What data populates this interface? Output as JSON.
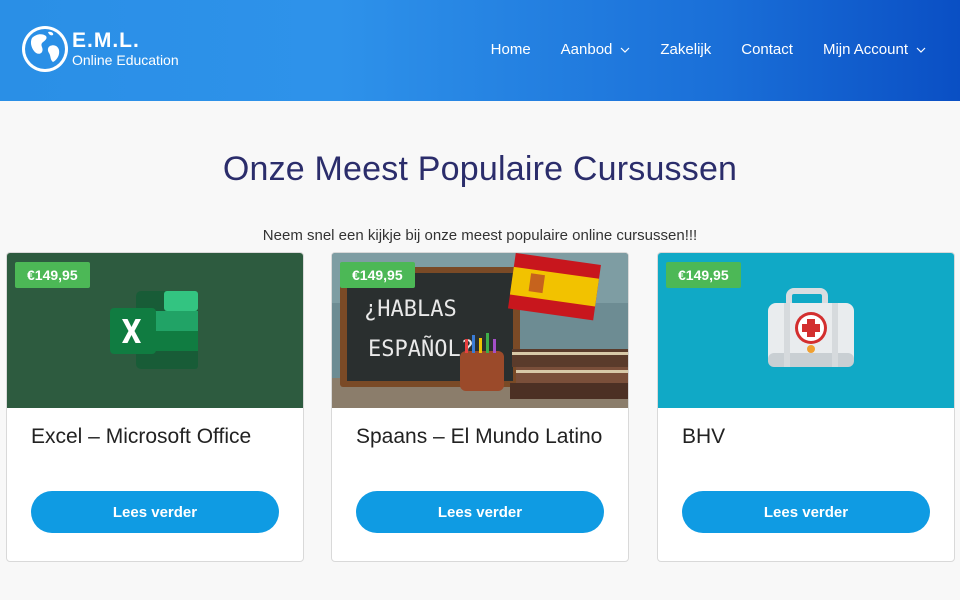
{
  "brand": {
    "title": "E.M.L.",
    "subtitle": "Online Education"
  },
  "nav": {
    "items": [
      {
        "label": "Home",
        "has_dropdown": false,
        "active": true
      },
      {
        "label": "Aanbod",
        "has_dropdown": true
      },
      {
        "label": "Zakelijk",
        "has_dropdown": false
      },
      {
        "label": "Contact",
        "has_dropdown": false
      },
      {
        "label": "Mijn Account",
        "has_dropdown": true
      }
    ]
  },
  "section": {
    "title": "Onze Meest Populaire Cursussen",
    "subtitle": "Neem snel een kijkje bij onze meest populaire online cursussen!!!"
  },
  "cards": [
    {
      "price": "€149,95",
      "title": "Excel – Microsoft Office",
      "button": "Lees verder",
      "image": "excel-logo",
      "bg_color": "#2d5b3f"
    },
    {
      "price": "€149,95",
      "title": "Spaans – El Mundo Latino",
      "button": "Lees verder",
      "image": "hablas-espanol-chalkboard",
      "chalk_text": [
        "¿HABLAS",
        "ESPAÑOL?"
      ]
    },
    {
      "price": "€149,95",
      "title": "BHV",
      "button": "Lees verder",
      "image": "first-aid-kit",
      "bg_color": "#10a9c6"
    }
  ],
  "colors": {
    "header_start": "#2a8fe6",
    "header_end": "#0a4fc4",
    "title": "#2b2d6b",
    "price_badge": "#4cb856",
    "button": "#0f9be3"
  }
}
